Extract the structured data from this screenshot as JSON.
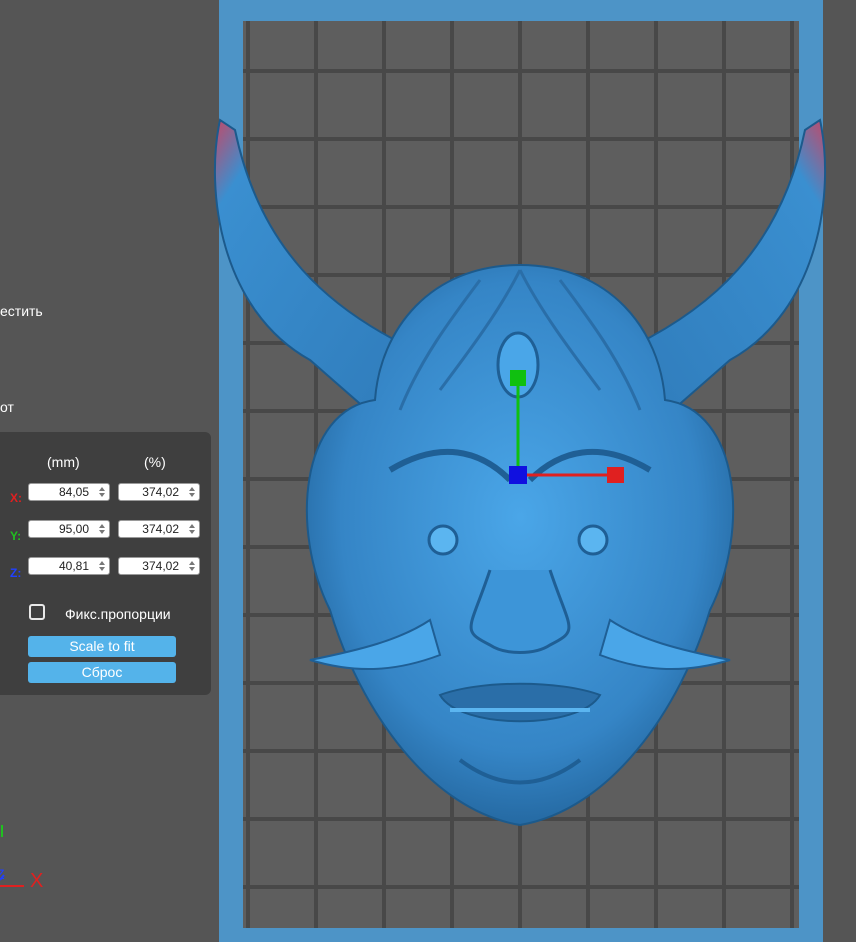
{
  "side_labels": {
    "place": "естить",
    "rotate": "от"
  },
  "scale_panel": {
    "unit_mm": "(mm)",
    "unit_percent": "(%)",
    "axes": [
      {
        "letter": "X:",
        "mm": "84,05",
        "percent": "374,02",
        "color": "#e02020"
      },
      {
        "letter": "Y:",
        "mm": "95,00",
        "percent": "374,02",
        "color": "#20c020"
      },
      {
        "letter": "Z:",
        "mm": "40,81",
        "percent": "374,02",
        "color": "#2040ff"
      }
    ],
    "lock_proportions_label": "Фикс.пропорции",
    "lock_proportions_checked": false,
    "scale_to_fit_label": "Scale to fit",
    "reset_label": "Сброс"
  },
  "axis_indicator": {
    "x_label": "X",
    "z_label": "Z"
  },
  "colors": {
    "background": "#555555",
    "panel": "#3f3f3f",
    "accent_button": "#54b3ea",
    "plate_frame": "#4d94c7",
    "model": "#3a8fd0",
    "gizmo_x": "#e02020",
    "gizmo_y": "#10c010",
    "gizmo_origin": "#1010e0"
  },
  "viewport": {
    "model_name": "oni-mask",
    "gizmo": "move-gizmo"
  }
}
